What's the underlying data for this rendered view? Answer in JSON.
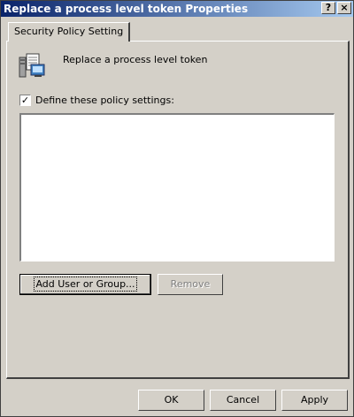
{
  "window": {
    "title": "Replace a process level token Properties",
    "help_label": "?",
    "close_label": "×"
  },
  "tabs": [
    {
      "label": "Security Policy Setting"
    }
  ],
  "policy": {
    "icon": "policy-document-icon",
    "name": "Replace a process level token"
  },
  "define_checkbox": {
    "checked": true,
    "mark": "✓",
    "label": "Define these policy settings:"
  },
  "user_list": {
    "items": []
  },
  "buttons": {
    "add": "Add User or Group...",
    "remove": "Remove",
    "ok": "OK",
    "cancel": "Cancel",
    "apply": "Apply"
  }
}
